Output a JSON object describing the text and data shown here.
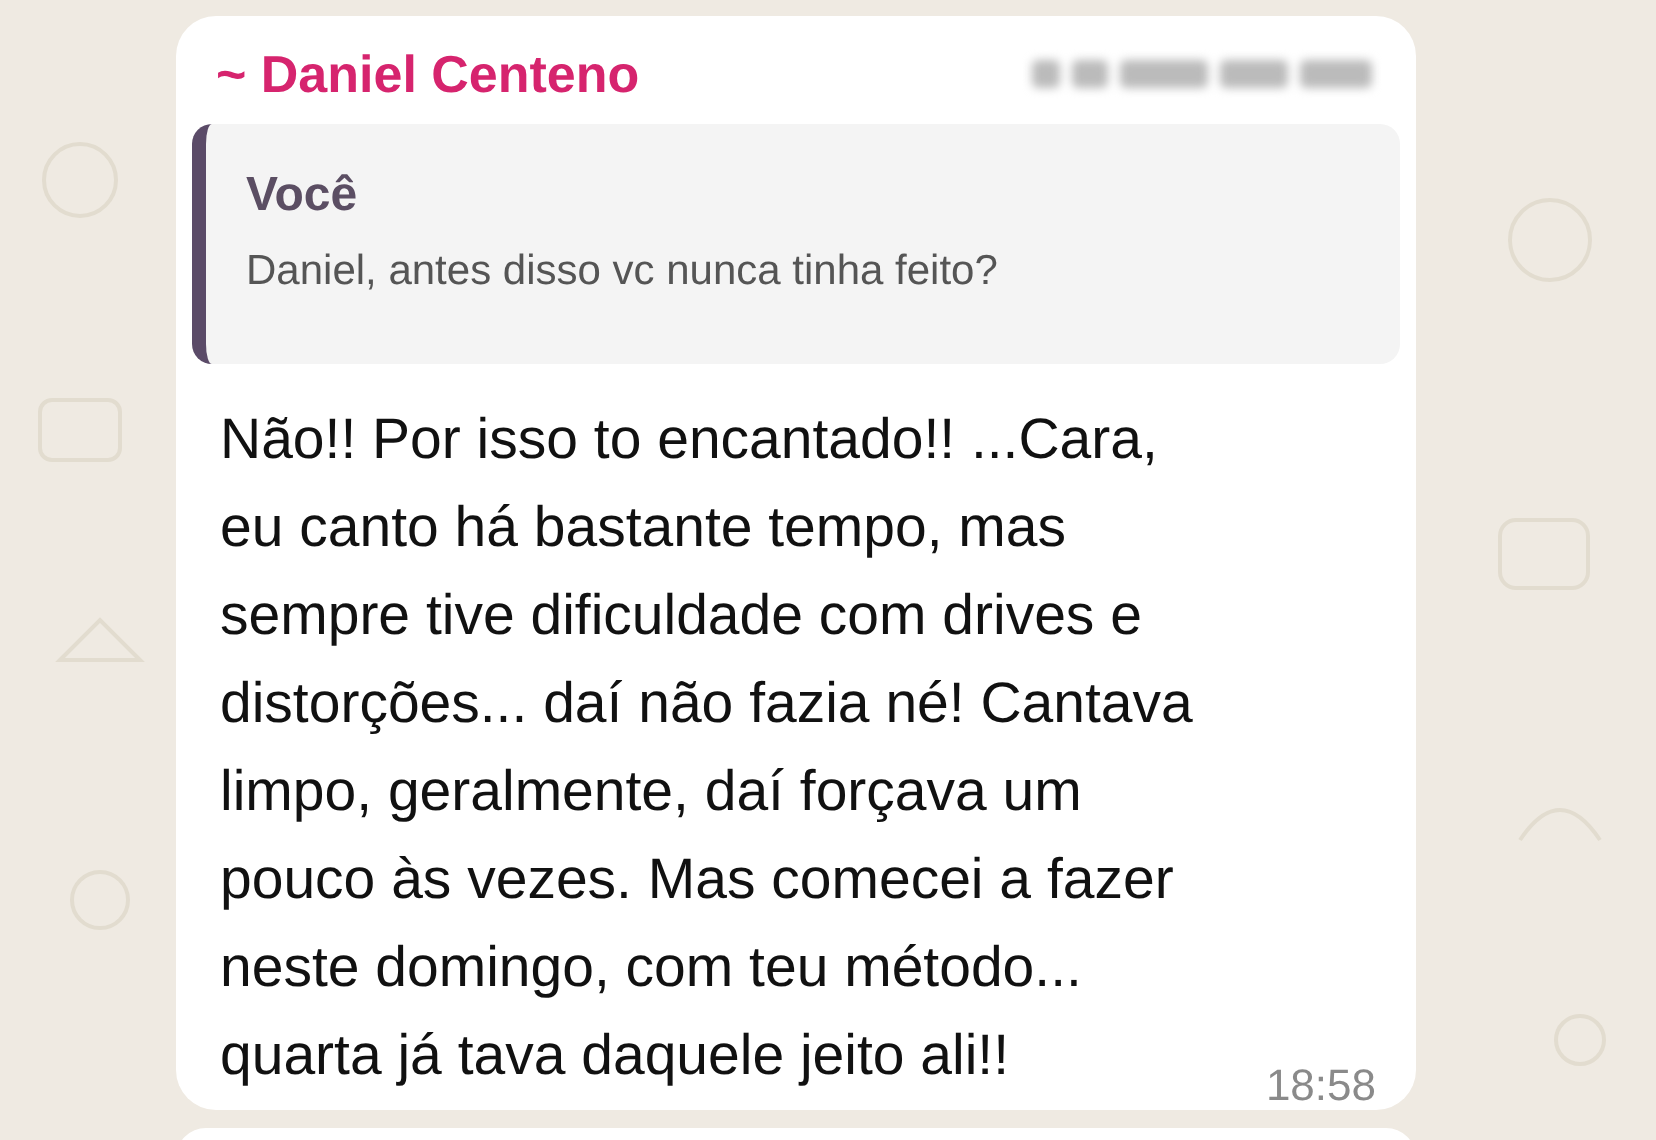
{
  "message": {
    "sender": "~ Daniel Centeno",
    "quote": {
      "author": "Você",
      "text": "Daniel, antes disso vc nunca tinha feito?"
    },
    "text": "Não!! Por isso to encantado!! ...Cara,\neu canto há bastante tempo, mas\nsempre tive dificuldade com drives e\ndistorções... daí não fazia né! Cantava\nlimpo, geralmente, daí forçava um\npouco às vezes. Mas comecei a fazer\nneste domingo, com teu método...\nquarta já tava daquele jeito ali!!",
    "time": "18:58"
  }
}
